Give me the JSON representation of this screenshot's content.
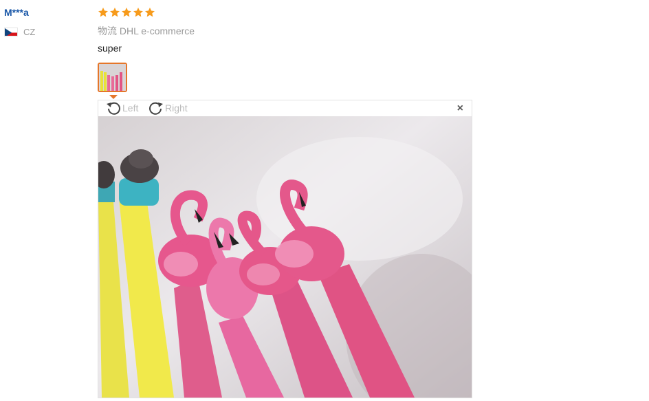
{
  "review": {
    "user_name": "M***a",
    "country_code": "CZ",
    "flag_icon": "czech-flag-icon",
    "rating": 5,
    "star_color": "#f79b1c",
    "logistics_label": "物流",
    "logistics_value": "DHL e-commerce",
    "text": "super"
  },
  "viewer": {
    "rotate_left_label": "Left",
    "rotate_right_label": "Right",
    "close_label": "×",
    "accent_color": "#e5762a"
  }
}
